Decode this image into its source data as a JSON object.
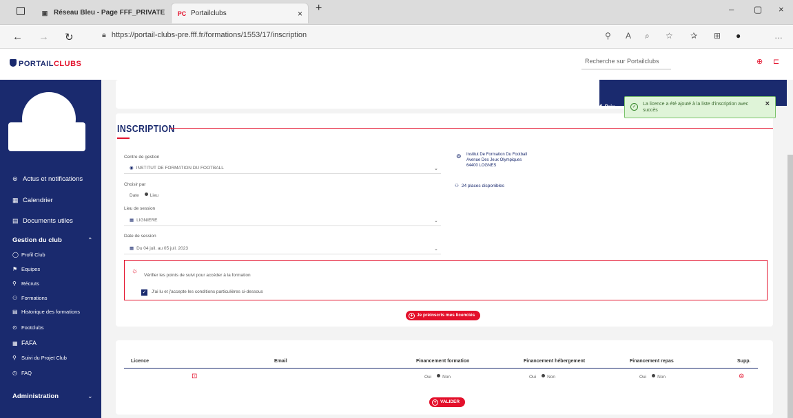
{
  "browser": {
    "tabs": [
      {
        "label": "Réseau Bleu - Page FFF_PRIVATE",
        "close": "×"
      },
      {
        "label": "Portailclubs",
        "favicon": "PC",
        "close": "×"
      }
    ],
    "new_tab": "+",
    "url": "https://portail-clubs-pre.fff.fr/formations/1553/17/inscription",
    "window_controls": {
      "min": "–",
      "max": "▢",
      "close": "×"
    }
  },
  "header": {
    "logo_text_1": "PORTAIL",
    "logo_text_2": "CLUBS",
    "search_placeholder": "Recherche sur Portailclubs"
  },
  "sidebar": {
    "items": [
      {
        "label": "Actus et notifications",
        "icon": "bell-icon"
      },
      {
        "label": "Calendrier",
        "icon": "calendar-icon"
      },
      {
        "label": "Documents utiles",
        "icon": "document-icon"
      }
    ],
    "group_label": "Gestion du club",
    "sub_items": [
      {
        "label": "Profil Club",
        "icon": "club-icon"
      },
      {
        "label": "Equipes",
        "icon": "team-icon"
      },
      {
        "label": "Récruts",
        "icon": "recruit-icon"
      },
      {
        "label": "Formations",
        "icon": "training-icon"
      },
      {
        "label": "Historique des formations",
        "icon": "history-icon"
      },
      {
        "label": "Footclubs",
        "icon": "footclubs-icon"
      },
      {
        "label": "FAFA",
        "icon": "fafa-icon"
      },
      {
        "label": "Suivi du Projet Club",
        "icon": "project-icon"
      },
      {
        "label": "FAQ",
        "icon": "faq-icon"
      }
    ],
    "admin_label": "Administration"
  },
  "toast": {
    "tab_label": "Prin",
    "message": "La licence a été ajouté à la liste d'inscription avec succès",
    "close": "×"
  },
  "form": {
    "title": "INSCRIPTION",
    "centre_label": "Centre de gestion",
    "centre_value": "INSTITUT DE FORMATION DU FOOTBALL",
    "choix_label": "Choisir par",
    "choix_options": [
      "Date",
      "Lieu"
    ],
    "lieu_label": "Lieu de session",
    "lieu_value": "LIGNIERE",
    "date_label": "Date de session",
    "date_value": "Du 04 juil. au 05 juil. 2023",
    "address_line1": "Institut De Formation Du Football",
    "address_line2": "Avenue Des Jeux Olympiques",
    "address_line3": "64400 LOGNES",
    "places": "24 places disponibles",
    "alert_msg": "Vérifier les points de suivi pour accéder à la formation",
    "checkbox_label": "J'ai lu et j'accepte les conditions particulières ci-dessous",
    "preinscribe_btn": "Je préinscris mes licenciés"
  },
  "table": {
    "headers": [
      "Licence",
      "Email",
      "Financement formation",
      "Financement hébergement",
      "Financement repas",
      "Supp."
    ],
    "row_opts": [
      "Oui",
      "Non"
    ],
    "validate_btn": "VALIDER"
  }
}
